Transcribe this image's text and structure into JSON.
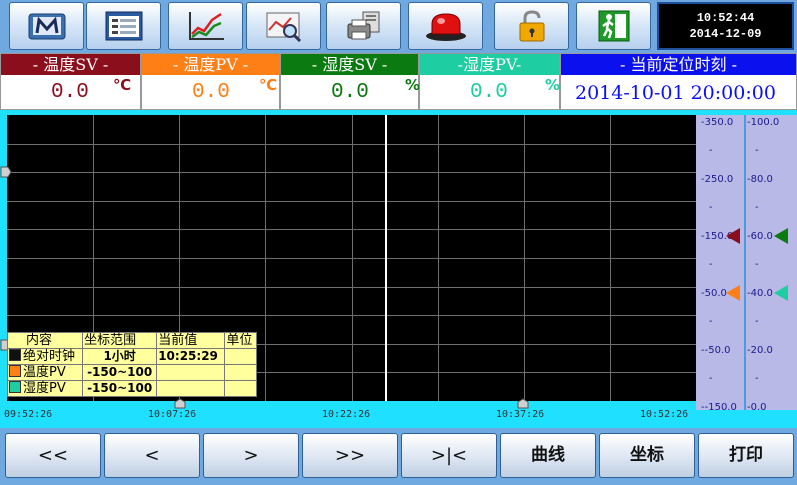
{
  "toolbar": {
    "buttons": [
      {
        "name": "logo-m-button",
        "icon": "m-logo-icon"
      },
      {
        "name": "list-view-button",
        "icon": "list-window-icon"
      },
      {
        "name": "trend-chart-button",
        "icon": "line-chart-icon"
      },
      {
        "name": "history-search-button",
        "icon": "chart-magnifier-icon"
      },
      {
        "name": "print-setup-button",
        "icon": "computer-printer-icon"
      },
      {
        "name": "alarm-button",
        "icon": "red-alarm-light-icon"
      },
      {
        "name": "lock-button",
        "icon": "padlock-icon"
      },
      {
        "name": "exit-button",
        "icon": "exit-door-icon"
      }
    ],
    "clock_time": "10:52:44",
    "clock_date": "2014-12-09"
  },
  "status": {
    "temp_sv": {
      "title": "- 温度SV -",
      "value": "0.0",
      "unit": "℃",
      "color": "#8b0e1c"
    },
    "temp_pv": {
      "title": "- 温度PV -",
      "value": "0.0",
      "unit": "℃",
      "color": "#ff7f17"
    },
    "hum_sv": {
      "title": "- 湿度SV -",
      "value": "0.0",
      "unit": "%",
      "color": "#0b7a10"
    },
    "hum_pv": {
      "title": "-湿度PV-",
      "value": "0.0",
      "unit": "%",
      "color": "#1ecda1"
    },
    "position_time": {
      "title": "- 当前定位时刻 -",
      "value": "2014-10-01 20:00:00",
      "color": "#0b10ee"
    }
  },
  "chart_data": {
    "type": "line",
    "series": [
      {
        "label": "温度PV",
        "range": "-150~100",
        "color": "#ff7f17",
        "values": []
      },
      {
        "label": "湿度PV",
        "range": "-150~100",
        "color": "#1ecda1",
        "values": []
      }
    ],
    "x_ticks": [
      "09:52:26",
      "10:07:26",
      "10:22:26",
      "10:37:26",
      "10:52:26"
    ],
    "cursor_time": "10:25:29",
    "left_axis": {
      "ticks": [
        "350.0",
        "250.0",
        "150.0",
        "50.0",
        "-50.0",
        "-150.0"
      ],
      "ylim": [
        -150,
        350
      ]
    },
    "right_axis": {
      "ticks": [
        "100.0",
        "80.0",
        "60.0",
        "40.0",
        "20.0",
        "0.0"
      ],
      "ylim": [
        0,
        100
      ]
    },
    "set_markers": [
      {
        "axis": "left",
        "value": 150,
        "color": "#8b0e1c"
      },
      {
        "axis": "left",
        "value": 50,
        "color": "#ff7f17"
      },
      {
        "axis": "right",
        "value": 60,
        "color": "#0b7a10"
      },
      {
        "axis": "right",
        "value": 40,
        "color": "#1ecda1"
      }
    ],
    "grid": true
  },
  "legend": {
    "headers": [
      "内容",
      "坐标范围",
      "当前值",
      "单位"
    ],
    "rows": [
      {
        "label": "绝对时钟",
        "range": "1小时",
        "value": "10:25:29",
        "unit": "",
        "color": "#111111"
      },
      {
        "label": "温度PV",
        "range": "-150~100",
        "value": "",
        "unit": "",
        "color": "#ff7f17"
      },
      {
        "label": "湿度PV",
        "range": "-150~100",
        "value": "",
        "unit": "",
        "color": "#1ecda1"
      }
    ]
  },
  "nav": {
    "buttons": [
      "<<",
      "<",
      ">",
      ">>",
      ">|<",
      "曲线",
      "坐标",
      "打印"
    ]
  }
}
